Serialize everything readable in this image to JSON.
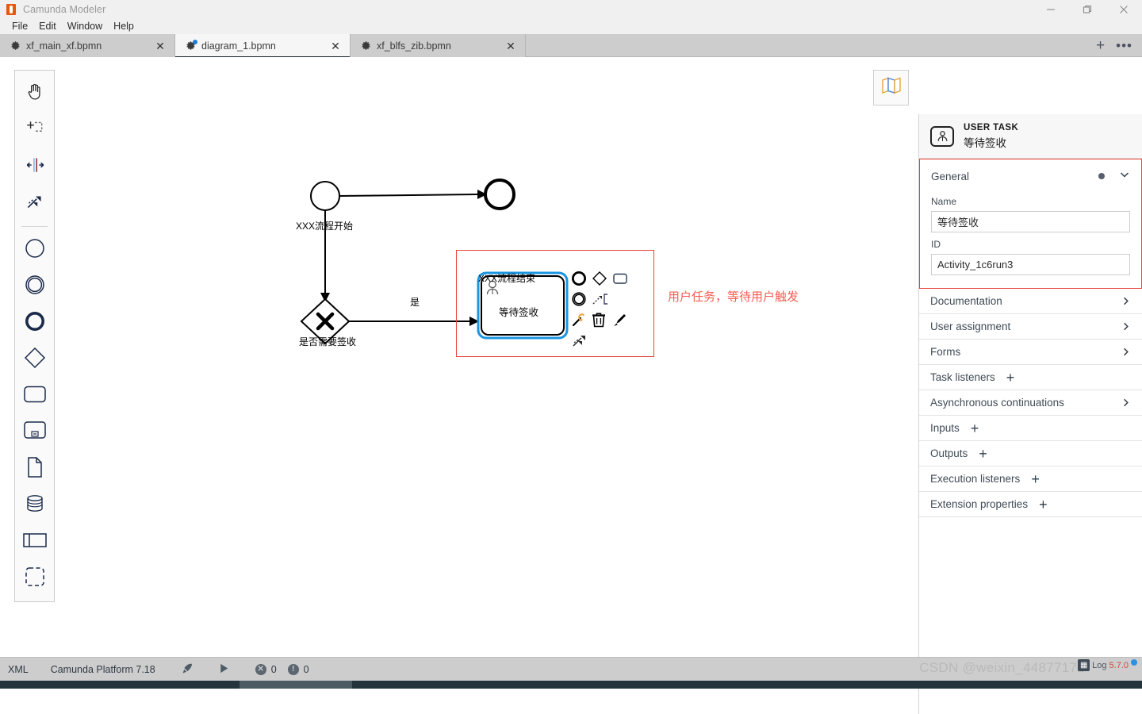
{
  "window": {
    "title": "Camunda Modeler",
    "logo_icon": "camunda-logo-icon",
    "minimize_label": "—",
    "maximize_label": "❐",
    "close_label": "✕"
  },
  "menubar": {
    "items": [
      {
        "label": "File"
      },
      {
        "label": "Edit"
      },
      {
        "label": "Window"
      },
      {
        "label": "Help"
      }
    ]
  },
  "tabs": {
    "items": [
      {
        "label": "xf_main_xf.bpmn",
        "icon": "bpmn-gear-icon",
        "active": false,
        "dirty": false,
        "close_label": "✕"
      },
      {
        "label": "diagram_1.bpmn",
        "icon": "bpmn-gear-icon",
        "active": true,
        "dirty": true,
        "close_label": "✕"
      },
      {
        "label": "xf_blfs_zib.bpmn",
        "icon": "bpmn-gear-icon",
        "active": false,
        "dirty": false,
        "close_label": "✕"
      }
    ],
    "add_label": "+",
    "more_label": "•••"
  },
  "palette": {
    "items": [
      {
        "name": "hand-tool-icon",
        "title": "Activate the hand tool"
      },
      {
        "name": "lasso-tool-icon",
        "title": "Activate the lasso tool"
      },
      {
        "name": "space-tool-icon",
        "title": "Activate the create/remove space tool"
      },
      {
        "name": "global-connect-tool-icon",
        "title": "Activate the global connect tool"
      },
      {
        "name": "start-event-icon",
        "title": "Create start event"
      },
      {
        "name": "intermediate-event-icon",
        "title": "Create intermediate/boundary event"
      },
      {
        "name": "end-event-icon",
        "title": "Create end event"
      },
      {
        "name": "gateway-icon",
        "title": "Create gateway"
      },
      {
        "name": "task-icon",
        "title": "Create task"
      },
      {
        "name": "subprocess-icon",
        "title": "Create expanded sub-process"
      },
      {
        "name": "data-object-icon",
        "title": "Create data object reference"
      },
      {
        "name": "data-store-icon",
        "title": "Create data store reference"
      },
      {
        "name": "participant-icon",
        "title": "Create pool/participant"
      },
      {
        "name": "group-icon",
        "title": "Create group"
      }
    ]
  },
  "canvas": {
    "minimap_icon": "map-icon",
    "elements": {
      "start_event_label": "XXX流程开始",
      "end_event_label": "XXX流程结束",
      "gateway_label": "是否需要签收",
      "flow_label_yes": "是",
      "user_task_label": "等待签收"
    },
    "annotation": {
      "text": "用户任务，等待用户触发",
      "color": "#fa5a50",
      "box_color": "#e8443a"
    },
    "context_pad": [
      {
        "name": "append-end-event-icon"
      },
      {
        "name": "append-gateway-icon"
      },
      {
        "name": "append-task-icon"
      },
      {
        "name": "append-intermediate-event-icon"
      },
      {
        "name": "append-text-annotation-icon"
      },
      {
        "name": "change-type-wrench-icon"
      },
      {
        "name": "delete-trash-icon"
      },
      {
        "name": "set-color-brush-icon"
      },
      {
        "name": "connect-icon"
      }
    ],
    "selection_color": "#1a95e0"
  },
  "properties": {
    "header": {
      "icon": "user-task-icon",
      "type": "USER TASK",
      "name": "等待签收"
    },
    "general": {
      "title": "General",
      "collapse_icon": "chevron-down-icon",
      "marker_icon": "dot-marker-icon",
      "fields": [
        {
          "label": "Name",
          "value": "等待签收",
          "name": "name-field"
        },
        {
          "label": "ID",
          "value": "Activity_1c6run3",
          "name": "id-field"
        }
      ]
    },
    "groups": [
      {
        "label": "Documentation",
        "action": "chevron",
        "action_icon": "chevron-right-icon"
      },
      {
        "label": "User assignment",
        "action": "chevron",
        "action_icon": "chevron-right-icon"
      },
      {
        "label": "Forms",
        "action": "chevron",
        "action_icon": "chevron-right-icon"
      },
      {
        "label": "Task listeners",
        "action": "plus",
        "action_icon": "plus-icon",
        "action_label": "+"
      },
      {
        "label": "Asynchronous continuations",
        "action": "chevron",
        "action_icon": "chevron-right-icon"
      },
      {
        "label": "Inputs",
        "action": "plus",
        "action_icon": "plus-icon",
        "action_label": "+"
      },
      {
        "label": "Outputs",
        "action": "plus",
        "action_icon": "plus-icon",
        "action_label": "+"
      },
      {
        "label": "Execution listeners",
        "action": "plus",
        "action_icon": "plus-icon",
        "action_label": "+"
      },
      {
        "label": "Extension properties",
        "action": "plus",
        "action_icon": "plus-icon",
        "action_label": "+"
      }
    ]
  },
  "statusbar": {
    "xml_label": "XML",
    "platform_label": "Camunda Platform 7.18",
    "deploy_icon": "rocket-icon",
    "run_icon": "play-icon",
    "error_icon": "error-circle-icon",
    "error_count": "0",
    "warning_icon": "warning-circle-icon",
    "warning_count": "0"
  },
  "watermark": {
    "text": "CSDN @weixin_44877172"
  },
  "float_widget": {
    "icon_label": "│",
    "log_label": "Log",
    "version_label": "5.7.0"
  }
}
